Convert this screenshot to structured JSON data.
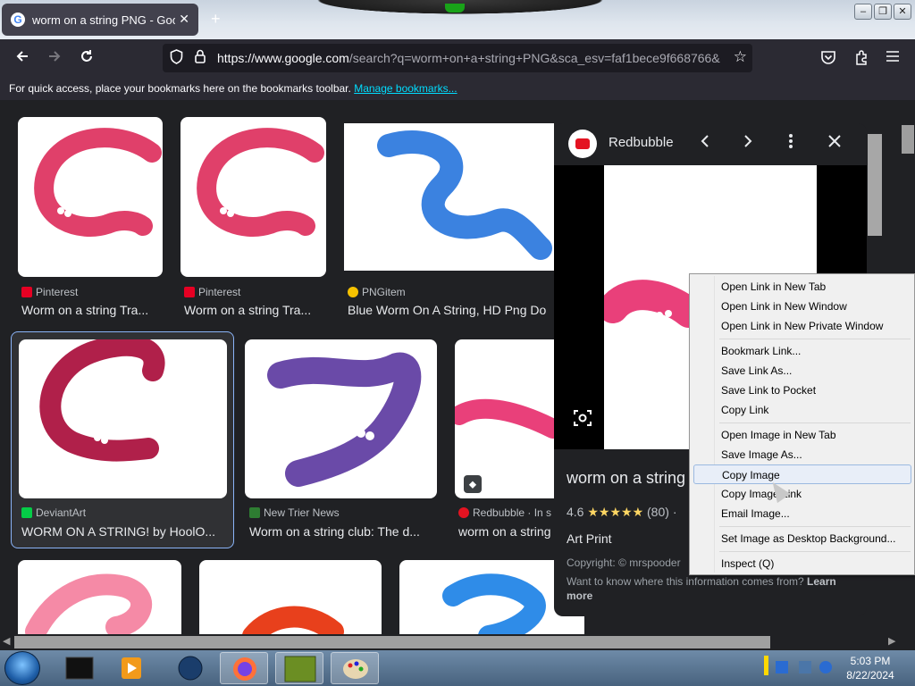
{
  "browser": {
    "tab_title": "worm on a string PNG - Google",
    "tab_icon": "google-favicon",
    "new_tab_symbol": "+",
    "url_host": "https://www.google.com",
    "url_rest": "/search?q=worm+on+a+string+PNG&sca_esv=faf1bece9f668766&",
    "window_buttons": [
      "–",
      "❐",
      "✕"
    ]
  },
  "bookmarks_bar": {
    "message": "For quick access, place your bookmarks here on the bookmarks toolbar.",
    "link": "Manage bookmarks..."
  },
  "results": [
    {
      "source": "Pinterest",
      "caption": "Worm on a string Tra...",
      "fav_color": "#e60023"
    },
    {
      "source": "Pinterest",
      "caption": "Worm on a string Tra...",
      "fav_color": "#e60023"
    },
    {
      "source": "PNGitem",
      "caption": "Blue Worm On A String, HD Png Do",
      "fav_color": "#f6c200"
    },
    {
      "source": "DeviantArt",
      "caption": "WORM ON A STRING! by HoolO...",
      "fav_color": "#05cc47"
    },
    {
      "source": "New Trier News",
      "caption": "Worm on a string club: The d...",
      "fav_color": "#2e7d32"
    },
    {
      "source": "Redbubble · In s",
      "caption": "worm on a string",
      "fav_color": "#e41321"
    }
  ],
  "panel": {
    "site": "Redbubble",
    "title": "worm on a string",
    "rating": "4.6",
    "stars": "★★★★★",
    "reviews": "(80)",
    "separator": "·",
    "product_type": "Art Print",
    "copyright": "Copyright: © mrspooder",
    "info_text": "Want to know where this information comes from?",
    "learn_more": "Learn more"
  },
  "context_menu": {
    "items": [
      "Open Link in New Tab",
      "Open Link in New Window",
      "Open Link in New Private Window",
      "Bookmark Link...",
      "Save Link As...",
      "Save Link to Pocket",
      "Copy Link",
      "Open Image in New Tab",
      "Save Image As...",
      "Copy Image",
      "Copy Image Link",
      "Email Image...",
      "Set Image as Desktop Background...",
      "Inspect (Q)"
    ],
    "highlighted": "Copy Image"
  },
  "taskbar": {
    "time": "5:03 PM",
    "date": "8/22/2024"
  },
  "colors": {
    "accent_link": "#00ddff",
    "selection_border": "#8ab4f8",
    "star": "#fdd663"
  }
}
